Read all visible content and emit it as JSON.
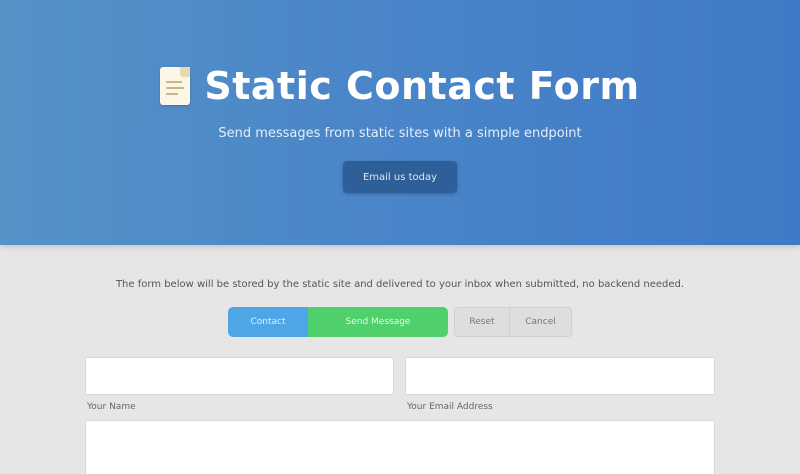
{
  "hero": {
    "title": "Static Contact Form",
    "subtitle": "Send messages from static sites with a simple endpoint",
    "button_label": "Email us today"
  },
  "intro": {
    "text": "The form below will be stored by the static site and delivered to your inbox when submitted, no backend needed."
  },
  "toolbar": {
    "buttons": [
      {
        "label": "Contact"
      },
      {
        "label": "Send Message"
      },
      {
        "label": "Reset"
      },
      {
        "label": "Cancel"
      }
    ]
  },
  "form": {
    "name_placeholder": "",
    "email_placeholder": "",
    "subject_label": "Your Name",
    "message_label": "Your Email Address",
    "message_placeholder": ""
  },
  "colors": {
    "hero_start": "#5592c8",
    "hero_end": "#3f7ac6",
    "primary_blue": "#4ea6e6",
    "primary_green": "#4fd06c",
    "page_bg": "#e6e6e6"
  },
  "icons": {
    "title_icon": "document-icon"
  }
}
